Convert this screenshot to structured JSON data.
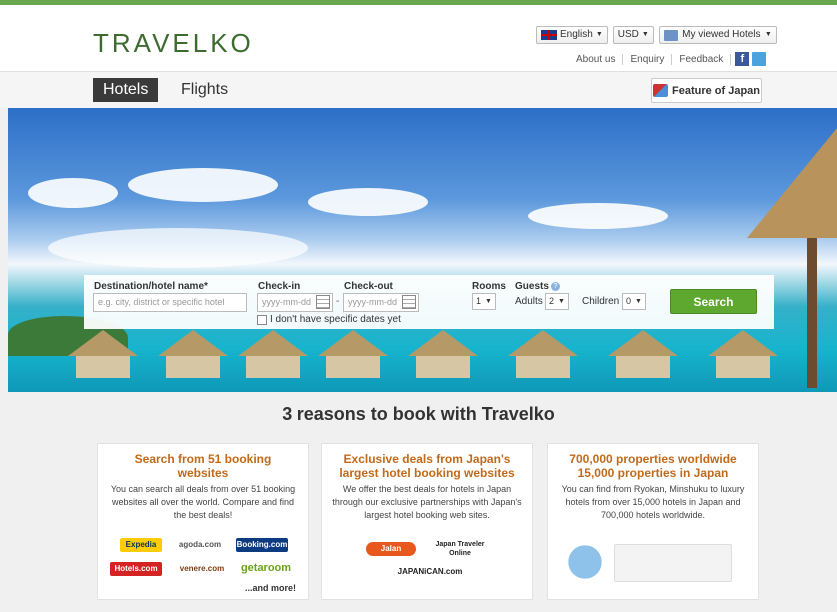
{
  "brand": {
    "logo": "TRAVELKO"
  },
  "header": {
    "language": "English",
    "currency": "USD",
    "history": "My viewed Hotels",
    "links": [
      "About us",
      "Enquiry",
      "Feedback"
    ],
    "facebook": "f"
  },
  "nav": {
    "tabs": [
      "Hotels",
      "Flights"
    ],
    "active_tab": "Hotels",
    "feature_button": "Feature of Japan"
  },
  "search": {
    "destination_label": "Destination/hotel name*",
    "destination_placeholder": "e.g. city, district or specific hotel",
    "checkin_label": "Check-in",
    "checkout_label": "Check-out",
    "date_placeholder": "yyyy-mm-dd",
    "date_separator": "-",
    "no_dates_label": "I don't have specific dates yet",
    "rooms_label": "Rooms",
    "rooms_value": "1",
    "guests_label": "Guests",
    "help_glyph": "?",
    "adults_label": "Adults",
    "adults_value": "2",
    "children_label": "Children",
    "children_value": "0",
    "search_button": "Search"
  },
  "reasons": {
    "count": "3",
    "title_rest": "reasons to book with Travelko",
    "cards": [
      {
        "title": "Search from 51 booking websites",
        "body": "You can search all deals from over 51 booking websites all over the world. Compare and find the best deals!",
        "logos": [
          "Expedia",
          "agoda.com",
          "Booking.com",
          "Hotels.com",
          "venere.com",
          "getaroom"
        ],
        "more": "...and more!"
      },
      {
        "title": "Exclusive deals from Japan's largest hotel booking websites",
        "body": "We offer the best deals for hotels in Japan through our exclusive partnerships with Japan's largest hotel booking web sites.",
        "logos": [
          "Jalan",
          "Japan Traveler Online",
          "JAPANiCAN.com"
        ]
      },
      {
        "title": "700,000 properties worldwide 15,000 properties in Japan",
        "body": "You can find from Ryokan, Minshuku to luxury hotels from over 15,000 hotels in Japan and 700,000 hotels worldwide."
      }
    ]
  }
}
